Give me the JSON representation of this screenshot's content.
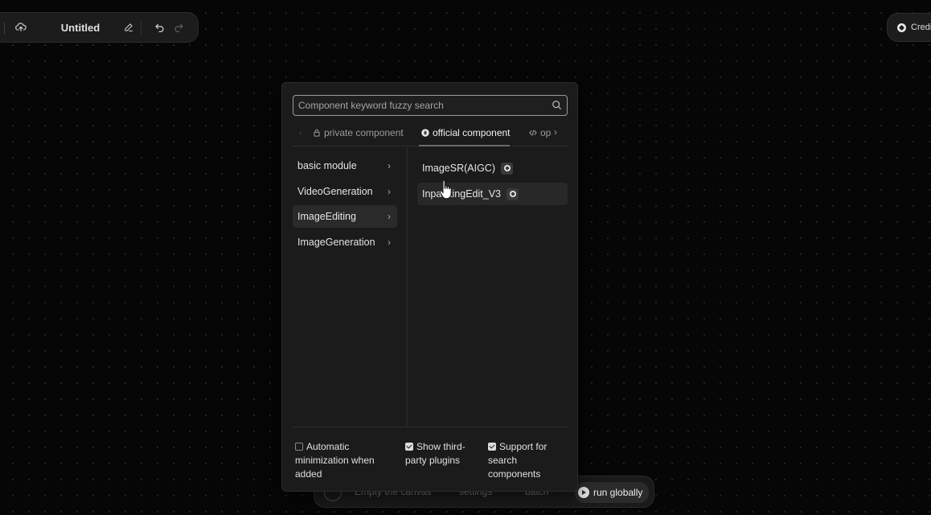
{
  "toolbar": {
    "title": "Untitled",
    "icons": [
      "cloud-upload-icon",
      "pencil-icon",
      "undo-icon",
      "redo-icon"
    ]
  },
  "credits": {
    "label": "Credi"
  },
  "bottom_bar": {
    "empty_label": "Empty the canvas",
    "settings_label": "settings",
    "batch_label": "batch",
    "run_label": "run globally"
  },
  "panel": {
    "search": {
      "placeholder": "Component keyword fuzzy search",
      "value": ""
    },
    "tabs": [
      {
        "label": "private component",
        "icon": "lock-icon",
        "active": false
      },
      {
        "label": "official component",
        "icon": "official-badge-icon",
        "active": true
      },
      {
        "label": "op",
        "icon": "code-icon",
        "active": false
      }
    ],
    "categories": [
      {
        "label": "basic module",
        "active": false
      },
      {
        "label": "VideoGeneration",
        "active": false
      },
      {
        "label": "ImageEditing",
        "active": true
      },
      {
        "label": "ImageGeneration",
        "active": false
      }
    ],
    "components": [
      {
        "label": "ImageSR(AIGC)",
        "hover": false
      },
      {
        "label": "InpaintingEdit_V3",
        "hover": true
      }
    ],
    "options": [
      {
        "label": "Automatic minimization when added",
        "checked": false
      },
      {
        "label": "Show third-party plugins",
        "checked": true
      },
      {
        "label": "Support for search components",
        "checked": true
      }
    ]
  },
  "colors": {
    "background": "#060606",
    "panel": "#1b1b1b",
    "active_item": "#2a2a2a",
    "text": "#e6e6e6"
  }
}
